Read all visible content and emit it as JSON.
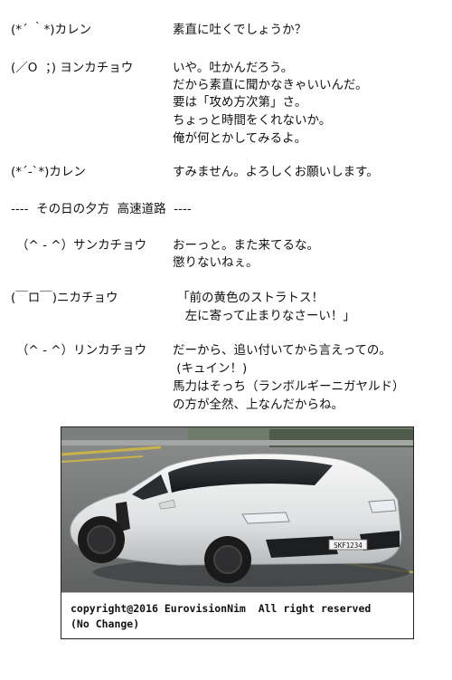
{
  "dialogue": [
    {
      "speaker": "(*´ ｀*)カレン",
      "lines": [
        "素直に吐くでしょうか？"
      ]
    },
    {
      "speaker": "(／O  ；) ヨンカチョウ",
      "lines": [
        "いや。吐かんだろう。",
        "だから素直に聞かなきゃいいんだ。",
        "要は「攻め方次第」さ。",
        "ちょっと時間をくれないか。",
        "俺が何とかしてみるよ。"
      ]
    },
    {
      "speaker": "(*´-`*)カレン",
      "lines": [
        "すみません。よろしくお願いします。"
      ]
    }
  ],
  "scene_divider": "----  その日の夕方  高速道路  ----",
  "dialogue2": [
    {
      "speaker": "（^ - ^）サンカチョウ",
      "lines": [
        "おーっと。また来てるな。",
        "懲りないねぇ。"
      ]
    },
    {
      "speaker": "(￣ロ￣)ニカチョウ",
      "lines": [
        "「前の黄色のストラトス！",
        "  左に寄って止まりなさーい！」"
      ]
    },
    {
      "speaker": "（^ - ^）リンカチョウ",
      "lines": [
        "だーから、追い付いてから言えっての。",
        " (キュイン！)",
        "馬力はそっち（ランボルギーニガヤルド）",
        "の方が全然、上なんだからね。"
      ]
    }
  ],
  "photo": {
    "license_plate": "SKF1234",
    "caption_line1": "copyright@2016 EurovisionNim  All right reserved",
    "caption_line2": "(No Change)"
  }
}
